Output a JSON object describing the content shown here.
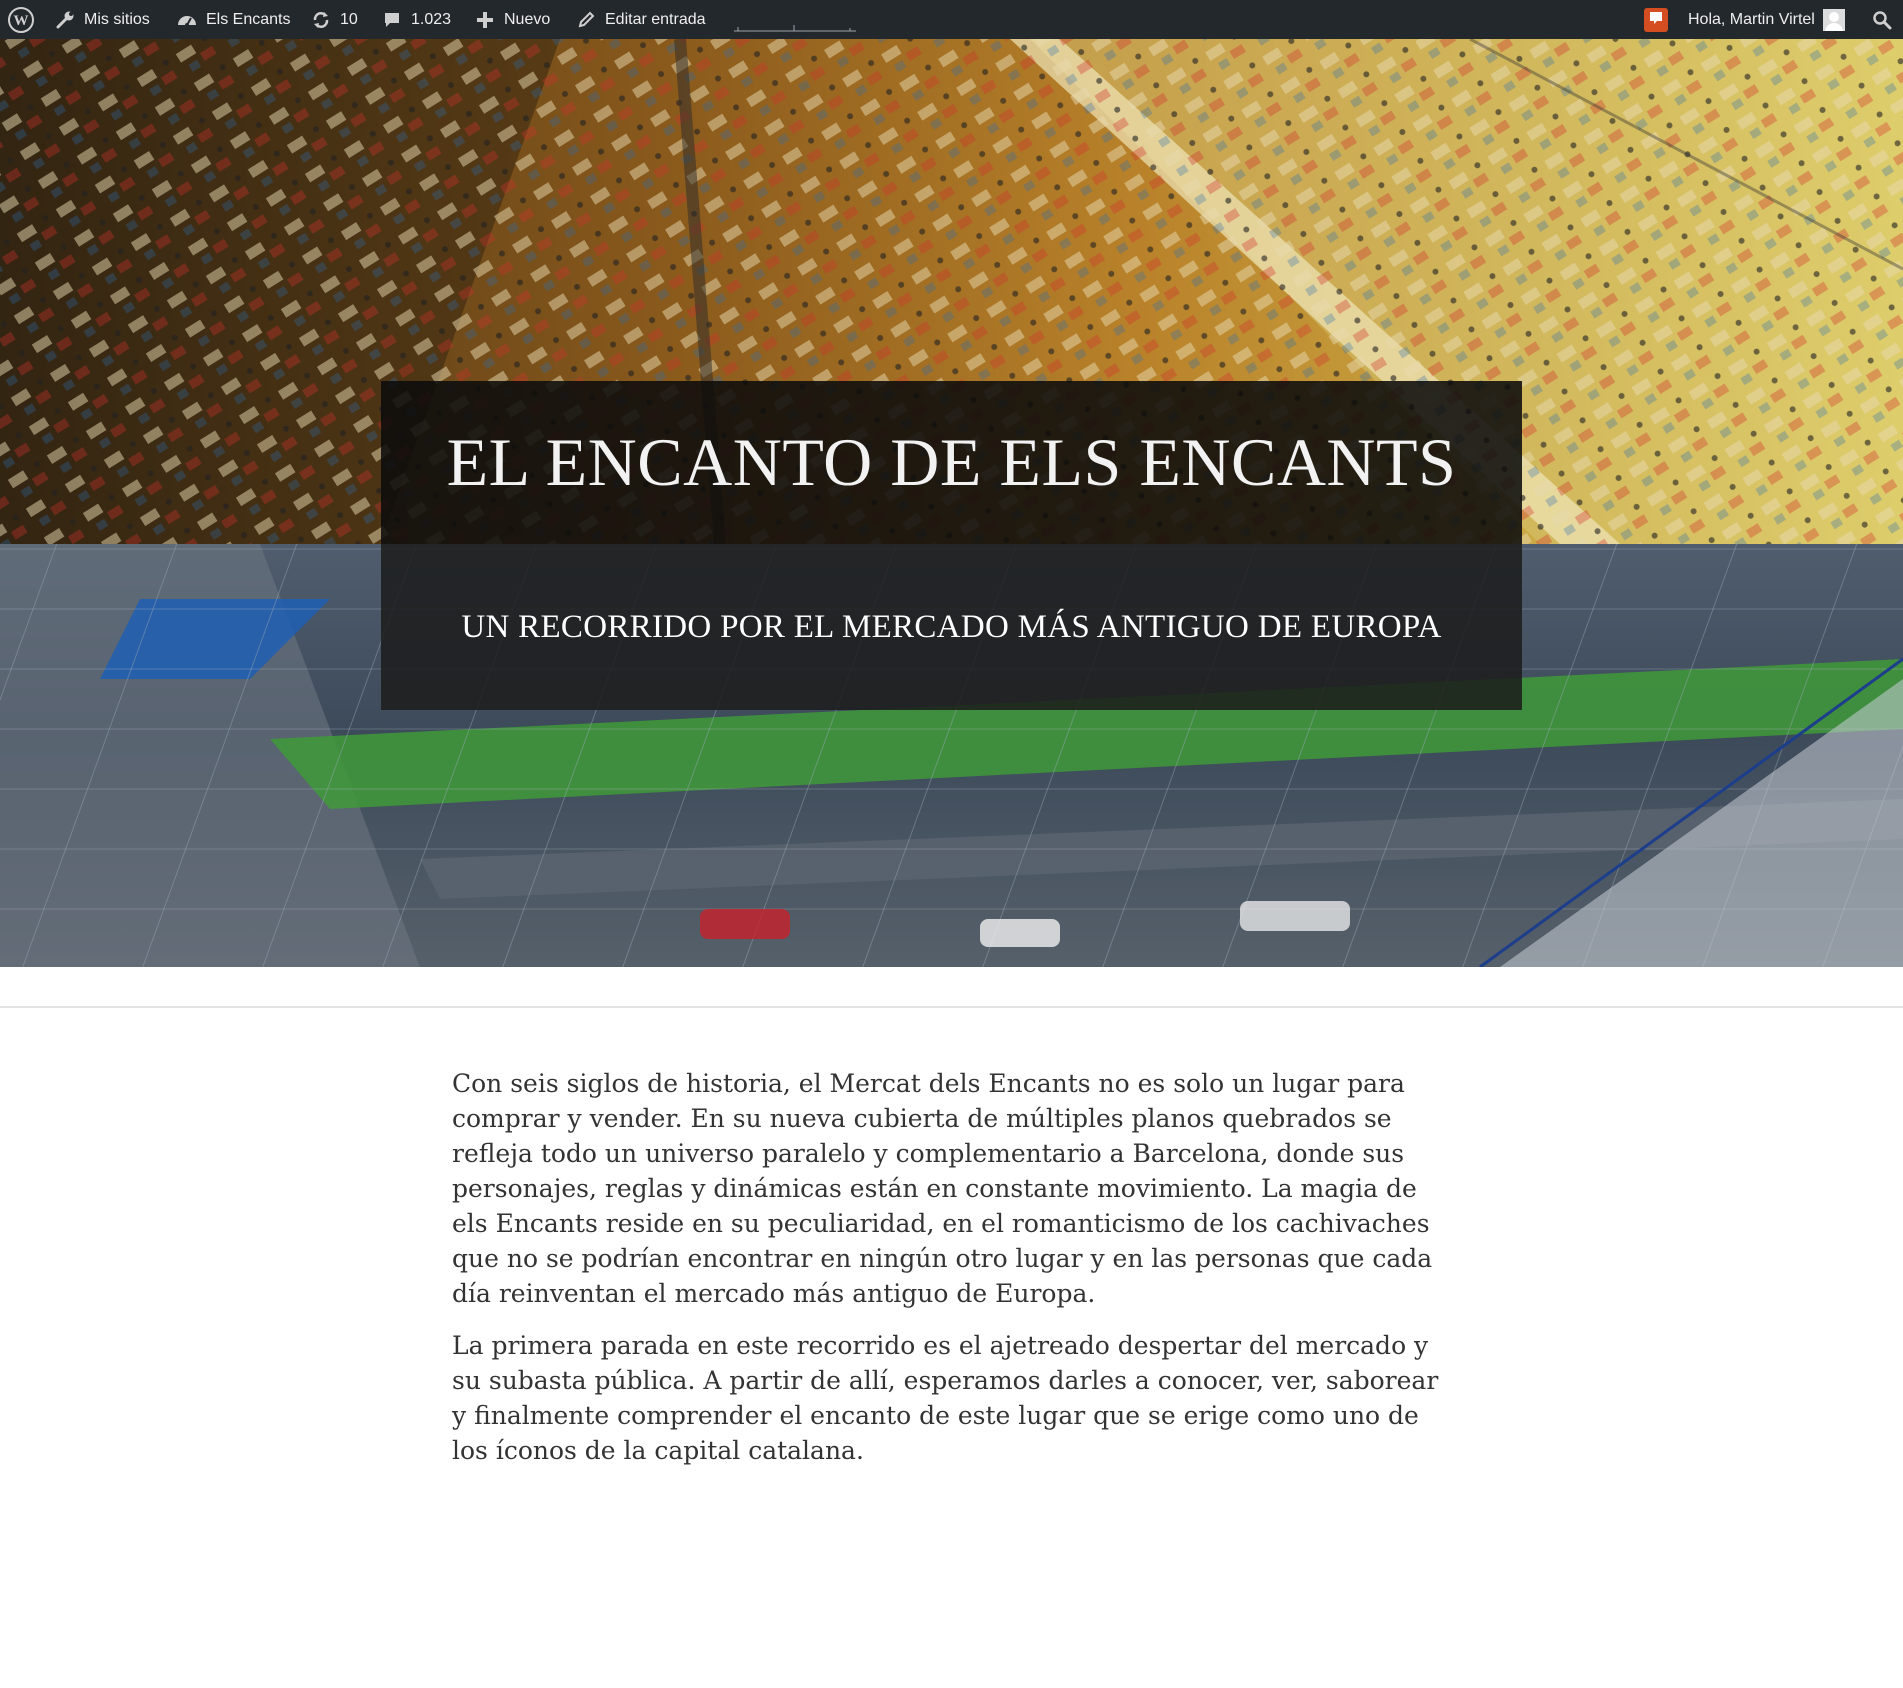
{
  "adminbar": {
    "my_sites": "Mis sitios",
    "site_name": "Els Encants",
    "updates_count": "10",
    "comments_count": "1.023",
    "new_label": "Nuevo",
    "edit_label": "Editar entrada",
    "greeting": "Hola, Martin Virtel",
    "icons": [
      "wordpress-logo",
      "wrench-icon",
      "dashboard-icon",
      "refresh-icon",
      "comment-icon",
      "plus-icon",
      "pencil-icon",
      "notification-icon",
      "search-icon"
    ]
  },
  "hero": {
    "title": "EL ENCANTO DE ELS ENCANTS",
    "subtitle": "UN RECORRIDO POR EL MERCADO MÁS ANTIGUO DE EUROPA"
  },
  "article": {
    "paragraphs": [
      "Con seis siglos de historia, el Mercat dels Encants no es solo un lugar para comprar y vender. En su nueva cubierta de múltiples planos quebrados se refleja todo un universo paralelo y complementario a Barcelona, donde sus personajes, reglas y dinámicas están en constante movimiento. La magia de els Encants reside en su peculiaridad, en el romanticismo de los cachivaches que no se podrían encontrar en ningún otro lugar y en las personas que cada día reinventan el mercado más antiguo de Europa.",
      "La primera parada en este recorrido es el ajetreado despertar del mercado y su subasta pública. A partir de allí, esperamos darles a conocer, ver, saborear y finalmente comprender el encanto de este lugar que se erige como uno de los íconos de la capital catalana."
    ]
  },
  "colors": {
    "adminbar_bg": "#23282d",
    "notification_orange": "#d54e21",
    "text": "#333333"
  }
}
